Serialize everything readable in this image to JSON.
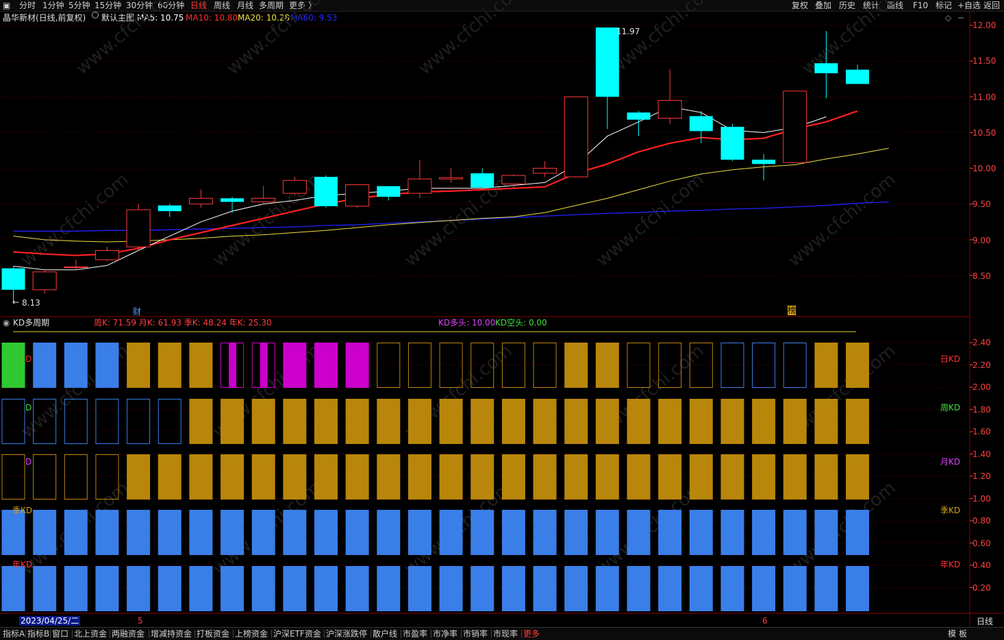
{
  "toolbar": {
    "periods": [
      "分时",
      "1分钟",
      "5分钟",
      "15分钟",
      "30分钟",
      "60分钟",
      "日线",
      "周线",
      "月线",
      "多周期",
      "更多 〉"
    ],
    "active_period": "日线",
    "right_buttons": [
      "复权",
      "叠加",
      "历史",
      "统计",
      "画线",
      "F10",
      "标记",
      "+自选",
      "返回"
    ]
  },
  "info": {
    "stock": "晶华新材(日线,前复权)",
    "template": "默认主图",
    "ma5": "MA5: 10.75",
    "ma10": "MA10: 10.80",
    "ma20": "MA20: 10.28",
    "ma60": "MA60: 9.53"
  },
  "kd_panel": {
    "title": "KD多周期",
    "values": "周K: 71.59  月K: 61.93  季K: 48.24  年K: 25.30",
    "bull": "KD多头: 10.00",
    "bear": "KD空头: 0.00",
    "row_labels": [
      "日KD",
      "周KD",
      "月KD",
      "季KD",
      "年KD"
    ],
    "inner_labels": [
      "D",
      "D",
      "D",
      "季KD",
      "年KD"
    ],
    "y_ticks": [
      "2.40",
      "2.20",
      "2.00",
      "1.80",
      "1.60",
      "1.40",
      "1.20",
      "1.00",
      "0.80",
      "0.60",
      "0.40",
      "0.20"
    ]
  },
  "price_axis": {
    "ticks": [
      "12.00",
      "11.50",
      "11.00",
      "10.50",
      "10.00",
      "9.50",
      "9.00",
      "8.50"
    ],
    "range": [
      8.13,
      12.1
    ]
  },
  "annotations": {
    "high": "11.97",
    "low": "8.13",
    "event_cai": "财",
    "event_bang": "榜",
    "date_label": "2023/04/25/二",
    "month_5": "5",
    "month_6": "6",
    "period_unit": "日线"
  },
  "bottom_tabs": [
    "指标A",
    "指标B",
    "窗口",
    "北上资金",
    "两融资金",
    "增减持资金",
    "打板资金",
    "上榜资金",
    "沪深ETF资金",
    "沪深涨跌停",
    "散户线",
    "市盈率",
    "市净率",
    "市销率",
    "市现率",
    "更多"
  ],
  "bottom_right": [
    "模",
    "板"
  ],
  "watermark": "www.cfchi.com",
  "colors": {
    "up": "#ff3b3b",
    "down": "#00ffff",
    "ma5": "#ffffff",
    "ma10": "#ff2020",
    "ma20": "#f0e040",
    "ma60": "#2222ff",
    "kd_gold": "#b8860b",
    "kd_blue": "#3a7ee8",
    "kd_magenta": "#cc00cc",
    "kd_green": "#30c830"
  },
  "chart_data": {
    "type": "candlestick",
    "candles": [
      {
        "o": 8.6,
        "h": 8.62,
        "l": 8.13,
        "c": 8.3
      },
      {
        "o": 8.3,
        "h": 8.58,
        "l": 8.25,
        "c": 8.55
      },
      {
        "o": 8.62,
        "h": 8.72,
        "l": 8.57,
        "c": 8.62
      },
      {
        "o": 8.72,
        "h": 8.9,
        "l": 8.7,
        "c": 8.85
      },
      {
        "o": 8.9,
        "h": 9.5,
        "l": 8.85,
        "c": 9.42
      },
      {
        "o": 9.48,
        "h": 9.5,
        "l": 9.32,
        "c": 9.4
      },
      {
        "o": 9.5,
        "h": 9.7,
        "l": 9.45,
        "c": 9.58
      },
      {
        "o": 9.58,
        "h": 9.6,
        "l": 9.38,
        "c": 9.53
      },
      {
        "o": 9.53,
        "h": 9.75,
        "l": 9.49,
        "c": 9.58
      },
      {
        "o": 9.65,
        "h": 9.88,
        "l": 9.62,
        "c": 9.83
      },
      {
        "o": 9.88,
        "h": 9.9,
        "l": 9.45,
        "c": 9.47
      },
      {
        "o": 9.47,
        "h": 9.78,
        "l": 9.45,
        "c": 9.77
      },
      {
        "o": 9.75,
        "h": 9.75,
        "l": 9.55,
        "c": 9.6
      },
      {
        "o": 9.65,
        "h": 10.12,
        "l": 9.58,
        "c": 9.85
      },
      {
        "o": 9.85,
        "h": 10.0,
        "l": 9.8,
        "c": 9.87
      },
      {
        "o": 9.93,
        "h": 10.0,
        "l": 9.73,
        "c": 9.73
      },
      {
        "o": 9.78,
        "h": 9.92,
        "l": 9.72,
        "c": 9.9
      },
      {
        "o": 9.93,
        "h": 10.1,
        "l": 9.88,
        "c": 10.0
      },
      {
        "o": 9.88,
        "h": 11.0,
        "l": 9.87,
        "c": 11.0
      },
      {
        "o": 11.97,
        "h": 11.97,
        "l": 10.55,
        "c": 11.0
      },
      {
        "o": 10.78,
        "h": 10.8,
        "l": 10.45,
        "c": 10.68
      },
      {
        "o": 10.7,
        "h": 11.38,
        "l": 10.62,
        "c": 10.95
      },
      {
        "o": 10.73,
        "h": 10.8,
        "l": 10.35,
        "c": 10.52
      },
      {
        "o": 10.58,
        "h": 10.62,
        "l": 10.1,
        "c": 10.12
      },
      {
        "o": 10.12,
        "h": 10.2,
        "l": 9.83,
        "c": 10.06
      },
      {
        "o": 10.08,
        "h": 11.08,
        "l": 10.08,
        "c": 11.08
      },
      {
        "o": 11.47,
        "h": 11.92,
        "l": 10.98,
        "c": 11.33
      },
      {
        "o": 11.38,
        "h": 11.45,
        "l": 11.18,
        "c": 11.18
      }
    ],
    "ma5": [
      8.63,
      8.58,
      8.58,
      8.64,
      8.85,
      9.05,
      9.25,
      9.4,
      9.5,
      9.55,
      9.62,
      9.65,
      9.68,
      9.72,
      9.72,
      9.72,
      9.76,
      9.8,
      10.05,
      10.45,
      10.65,
      10.86,
      10.78,
      10.53,
      10.5,
      10.57,
      10.72
    ],
    "ma10": [
      8.83,
      8.8,
      8.78,
      8.8,
      8.88,
      9.0,
      9.1,
      9.2,
      9.3,
      9.4,
      9.5,
      9.58,
      9.63,
      9.67,
      9.68,
      9.7,
      9.72,
      9.74,
      9.93,
      10.06,
      10.23,
      10.35,
      10.43,
      10.4,
      10.42,
      10.55,
      10.65,
      10.8
    ],
    "ma20": [
      9.05,
      9.0,
      8.98,
      8.97,
      8.98,
      9.0,
      9.02,
      9.05,
      9.07,
      9.1,
      9.13,
      9.17,
      9.21,
      9.24,
      9.27,
      9.3,
      9.32,
      9.38,
      9.48,
      9.58,
      9.7,
      9.82,
      9.92,
      9.98,
      10.02,
      10.05,
      10.13,
      10.2,
      10.28
    ],
    "ma60": [
      9.12,
      9.12,
      9.12,
      9.13,
      9.13,
      9.14,
      9.15,
      9.16,
      9.17,
      9.18,
      9.2,
      9.21,
      9.23,
      9.25,
      9.27,
      9.29,
      9.31,
      9.33,
      9.35,
      9.37,
      9.38,
      9.4,
      9.41,
      9.43,
      9.44,
      9.46,
      9.48,
      9.51,
      9.53
    ],
    "kd_rows": [
      [
        "green",
        "blue",
        "blue",
        "blue",
        "gold",
        "gold",
        "gold",
        "magenta_half",
        "magenta_half",
        "magenta",
        "magenta",
        "magenta",
        "gold_outline",
        "gold_outline",
        "gold_outline",
        "gold_outline",
        "gold_outline",
        "gold_outline",
        "gold",
        "gold",
        "gold_outline",
        "gold_outline",
        "gold_outline",
        "blue_outline",
        "blue_outline",
        "blue_outline",
        "gold",
        "gold"
      ],
      [
        "blue_outline",
        "blue_outline",
        "blue_outline",
        "blue_outline",
        "blue_outline",
        "blue_outline",
        "gold",
        "gold",
        "gold",
        "gold",
        "gold",
        "gold",
        "gold",
        "gold",
        "gold",
        "gold",
        "gold",
        "gold",
        "gold",
        "gold",
        "gold",
        "gold",
        "gold",
        "gold",
        "gold",
        "gold",
        "gold",
        "gold"
      ],
      [
        "gold_outline",
        "gold_outline",
        "gold_outline",
        "gold_outline",
        "gold",
        "gold",
        "gold",
        "gold",
        "gold",
        "gold",
        "gold",
        "gold",
        "gold",
        "gold",
        "gold",
        "gold",
        "gold",
        "gold",
        "gold",
        "gold",
        "gold",
        "gold",
        "gold",
        "gold",
        "gold",
        "gold",
        "gold",
        "gold"
      ],
      [
        "blue",
        "blue",
        "blue",
        "blue",
        "blue",
        "blue",
        "blue",
        "blue",
        "blue",
        "blue",
        "blue",
        "blue",
        "blue",
        "blue",
        "blue",
        "blue",
        "blue",
        "blue",
        "blue",
        "blue",
        "blue",
        "blue",
        "blue",
        "blue",
        "blue",
        "blue",
        "blue",
        "blue"
      ],
      [
        "blue",
        "blue",
        "blue",
        "blue",
        "blue",
        "blue",
        "blue",
        "blue",
        "blue",
        "blue",
        "blue",
        "blue",
        "blue",
        "blue",
        "blue",
        "blue",
        "blue",
        "blue",
        "blue",
        "blue",
        "blue",
        "blue",
        "blue",
        "blue",
        "blue",
        "blue",
        "blue",
        "blue"
      ]
    ]
  }
}
